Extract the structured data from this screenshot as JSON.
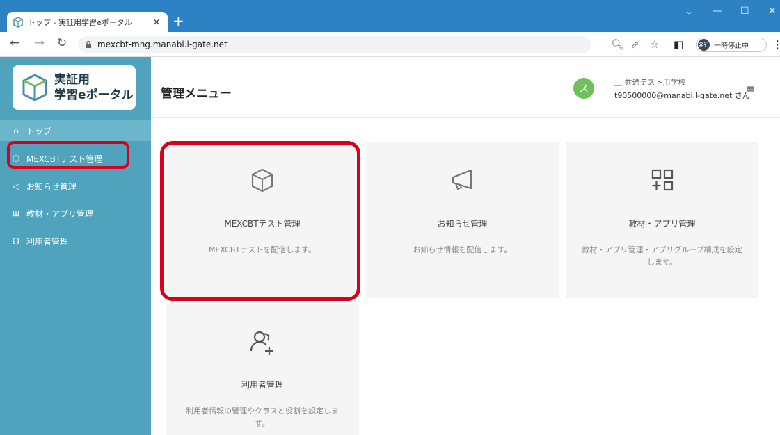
{
  "browser": {
    "tab_title": "トップ - 実証用学習eポータル",
    "tab_close": "×",
    "new_tab": "+",
    "url": "mexcbt-mng.manabi.l-gate.net",
    "profile_badge": "発行",
    "paused_label": "一時停止中"
  },
  "sidebar": {
    "logo_line1": "実証用",
    "logo_line2": "学習eポータル",
    "items": [
      {
        "label": "トップ",
        "icon": "home-icon"
      },
      {
        "label": "MEXCBTテスト管理",
        "icon": "cube-icon"
      },
      {
        "label": "お知らせ管理",
        "icon": "megaphone-icon"
      },
      {
        "label": "教材・アプリ管理",
        "icon": "grid-plus-icon"
      },
      {
        "label": "利用者管理",
        "icon": "users-icon"
      }
    ]
  },
  "header": {
    "title": "管理メニュー",
    "avatar_letter": "ス",
    "school": "＿ 共通テスト用学校",
    "email": "t90500000@manabi.l-gate.net さん"
  },
  "cards": [
    {
      "title": "MEXCBTテスト管理",
      "desc": "MEXCBTテストを配信します。",
      "icon": "cube-icon"
    },
    {
      "title": "お知らせ管理",
      "desc": "お知らせ情報を配信します。",
      "icon": "megaphone-icon"
    },
    {
      "title": "教材・アプリ管理",
      "desc": "教材・アプリ管理・アプリグループ構成を設定します。",
      "icon": "grid-plus-icon"
    },
    {
      "title": "利用者管理",
      "desc": "利用者情報の管理やクラスと役割を設定します。",
      "icon": "users-add-icon"
    }
  ],
  "colors": {
    "sidebar": "#4fa3bd",
    "highlight": "#d9001b",
    "avatar": "#6fbf5a",
    "browser_bar": "#2d82c4"
  }
}
